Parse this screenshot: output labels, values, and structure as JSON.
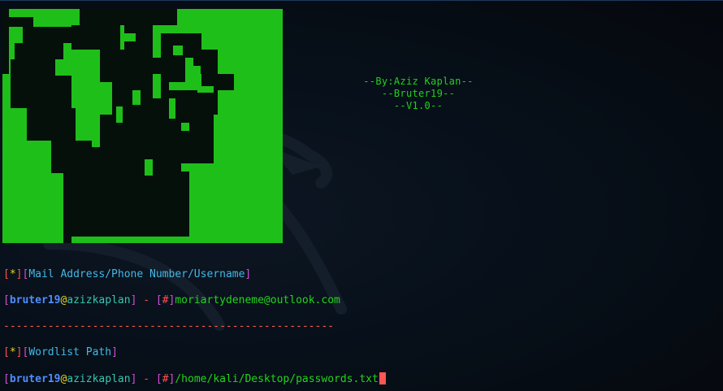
{
  "banner": {
    "author": "--By:Aziz Kaplan--",
    "tool": "--Bruter19--",
    "version": "--V1.0--"
  },
  "prompt_mail": {
    "bracket_open": "[",
    "star": "*",
    "bracket_close": "]",
    "label_open": "[",
    "label": "Mail Address/Phone Number/Username",
    "label_close": "]"
  },
  "input_mail": {
    "user": "bruter19",
    "at": "@",
    "host": "azizkaplan",
    "separator": " - ",
    "hash": "#",
    "value": "moriartydeneme@outlook.com"
  },
  "separator_line": "----------------------------------------------------",
  "prompt_wordlist": {
    "label": "Wordlist Path"
  },
  "input_wordlist": {
    "user": "bruter19",
    "at": "@",
    "host": "azizkaplan",
    "separator": " - ",
    "hash": "#",
    "value": "/home/kali/Desktop/passwords.txt"
  },
  "colors": {
    "background": "#06090f",
    "ascii_green": "#1fbf1a",
    "banner_green": "#22d11c",
    "cursor": "#ff5555"
  }
}
